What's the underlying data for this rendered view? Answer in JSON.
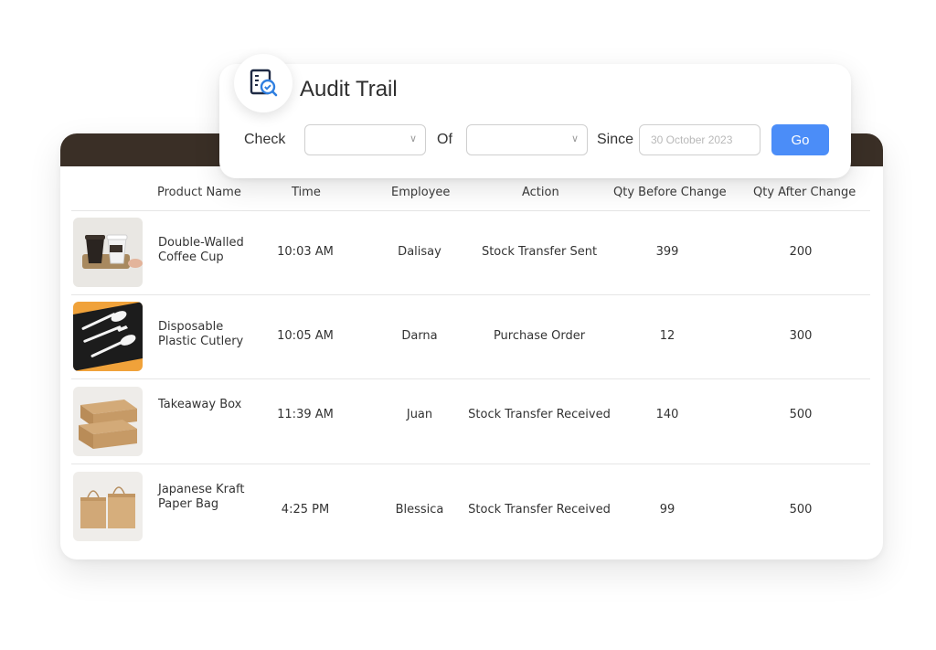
{
  "audit": {
    "title": "Audit Trail",
    "check_label": "Check",
    "of_label": "Of",
    "since_label": "Since",
    "since_placeholder": "30 October 2023",
    "go_label": "Go"
  },
  "table": {
    "columns": [
      "Product Name",
      "Time",
      "Employee",
      "Action",
      "Qty Before Change",
      "Qty After Change"
    ],
    "rows": [
      {
        "product": "Double-Walled Coffee Cup",
        "time": "10:03 AM",
        "employee": "Dalisay",
        "action": "Stock Transfer Sent",
        "qty_before": "399",
        "qty_after": "200"
      },
      {
        "product": "Disposable Plastic Cutlery",
        "time": "10:05 AM",
        "employee": "Darna",
        "action": "Purchase Order",
        "qty_before": "12",
        "qty_after": "300"
      },
      {
        "product": "Takeaway Box",
        "time": "11:39 AM",
        "employee": "Juan",
        "action": "Stock Transfer Received",
        "qty_before": "140",
        "qty_after": "500"
      },
      {
        "product": "Japanese Kraft Paper Bag",
        "time": "4:25 PM",
        "employee": "Blessica",
        "action": "Stock Transfer Received",
        "qty_before": "99",
        "qty_after": "500"
      }
    ]
  },
  "colors": {
    "header_bar": "#3a2f26",
    "go_button": "#4b8df8",
    "icon_blue": "#2f7fe0"
  },
  "icons": {
    "audit": "document-search-icon",
    "dropdown": "chevron-down-icon"
  }
}
